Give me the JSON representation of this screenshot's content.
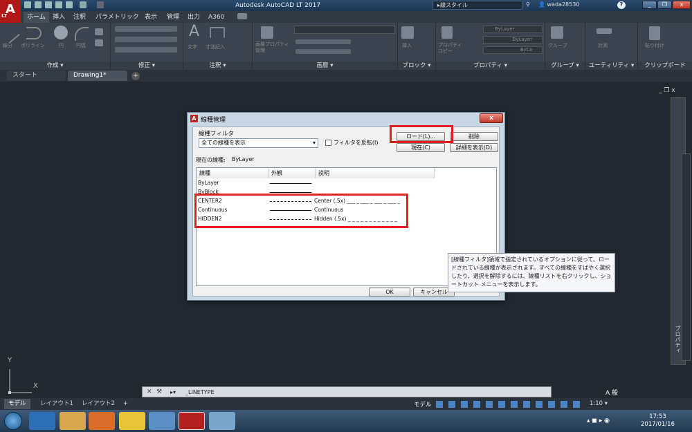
{
  "app": {
    "title": "Autodesk AutoCAD LT 2017",
    "logo": "A",
    "logo_sub": "LT",
    "search_label": "線スタイル",
    "user": "wada28530"
  },
  "ribbon_tabs": [
    "ホーム",
    "挿入",
    "注釈",
    "パラメトリック",
    "表示",
    "管理",
    "出力",
    "A360"
  ],
  "ribbon_groups": [
    "作成 ▾",
    "修正 ▾",
    "注釈 ▾",
    "画層 ▾",
    "ブロック ▾",
    "プロパティ ▾",
    "グループ ▾",
    "ユーティリティ ▾",
    "クリップボード"
  ],
  "ribbon_small_labels": {
    "line": "線分",
    "polyline": "ポリライン",
    "circle": "円",
    "arc": "円弧",
    "text": "文字",
    "dim": "寸法記入",
    "layer_props": "画層プロパティ管理",
    "insert": "挿入",
    "match": "プロパティコピー",
    "group": "グループ",
    "measure": "計測",
    "paste": "貼り付け",
    "bylayer1": "ByLayer",
    "bylayer2": "ByLayer",
    "bylayer3": "ByLa"
  },
  "doc_tabs": [
    "スタート",
    "Drawing1*"
  ],
  "dialog": {
    "title": "線種管理",
    "filter_label": "線種フィルタ",
    "filter_value": "全ての線種を表示",
    "invert_label": "フィルタを反転(I)",
    "load_button": "ロード(L)...",
    "delete_button": "削除",
    "current_button": "現在(C)",
    "details_button": "詳細を表示(D)",
    "current_label": "現在の線種:",
    "current_value": "ByLayer",
    "columns": [
      "線種",
      "外観",
      "説明"
    ],
    "rows": [
      {
        "name": "ByLayer",
        "desc": ""
      },
      {
        "name": "ByBlock",
        "desc": ""
      },
      {
        "name": "CENTER2",
        "desc": "Center (.5x) ___ _ ___ _ ___ _ ___ _"
      },
      {
        "name": "Continuous",
        "desc": "Continuous"
      },
      {
        "name": "HIDDEN2",
        "desc": "Hidden (.5x) _ _ _ _ _ _ _ _ _ _ _ _"
      }
    ],
    "ok_button": "OK",
    "cancel_button": "キャンセル",
    "close_glyph": "x"
  },
  "tooltip": "[線種フィルタ]領域で指定されているオプションに従って、ロードされている線種が表示されます。すべての線種をすばやく選択したり、選択を解除するには、線種リストを右クリックし、ショートカット メニューを表示します。",
  "command": {
    "value": "_LINETYPE",
    "prefix": "▸▾"
  },
  "layout_tabs": [
    "モデル",
    "レイアウト1",
    "レイアウト2",
    "+"
  ],
  "status": {
    "model": "モデル",
    "scale": "1:10 ▾"
  },
  "palette_label": "プロパティ",
  "ucs": {
    "x": "X",
    "y": "Y"
  },
  "window_controls": {
    "min": "_",
    "restore": "❐",
    "close": "x"
  },
  "taskbar": {
    "time": "17:53",
    "date": "2017/01/16",
    "ime": "A 般"
  }
}
